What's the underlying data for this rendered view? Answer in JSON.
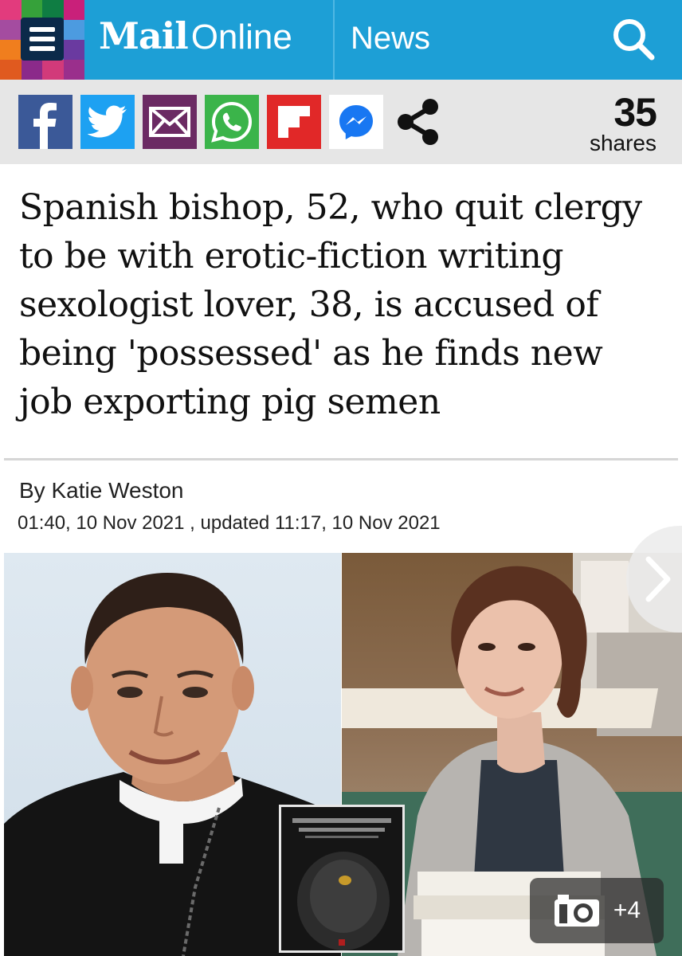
{
  "header": {
    "brand_mail": "Mail",
    "brand_online": "Online",
    "section": "News",
    "colors": {
      "bar": "#1d9fd6",
      "menu_box": "#0b2a4a"
    },
    "icons": {
      "menu": "hamburger-menu-icon",
      "search": "search-icon"
    }
  },
  "share": {
    "buttons": [
      {
        "name": "facebook",
        "icon": "facebook-icon",
        "color": "#3b5998"
      },
      {
        "name": "twitter",
        "icon": "twitter-icon",
        "color": "#1da1f2"
      },
      {
        "name": "email",
        "icon": "email-icon",
        "color": "#6b2a63"
      },
      {
        "name": "whatsapp",
        "icon": "whatsapp-icon",
        "color": "#3bb44a"
      },
      {
        "name": "flipboard",
        "icon": "flipboard-icon",
        "color": "#e12828"
      },
      {
        "name": "messenger",
        "icon": "messenger-icon",
        "color": "#ffffff"
      },
      {
        "name": "more-share",
        "icon": "share-icon",
        "color": "#e6e6e6"
      }
    ],
    "count": "35",
    "count_label": "shares"
  },
  "article": {
    "headline": "Spanish bishop, 52, who quit clergy to be with erotic-fiction writing sexologist lover, 38, is accused of being 'possessed' as he finds new job exporting pig semen",
    "byline_prefix": "By",
    "author": "Katie Weston",
    "published": "01:40, 10 Nov 2021",
    "updated_label": ", updated",
    "updated": "11:17, 10 Nov 2021"
  },
  "gallery": {
    "count": "+4",
    "icons": {
      "camera": "camera-icon",
      "next": "chevron-right-icon"
    }
  }
}
